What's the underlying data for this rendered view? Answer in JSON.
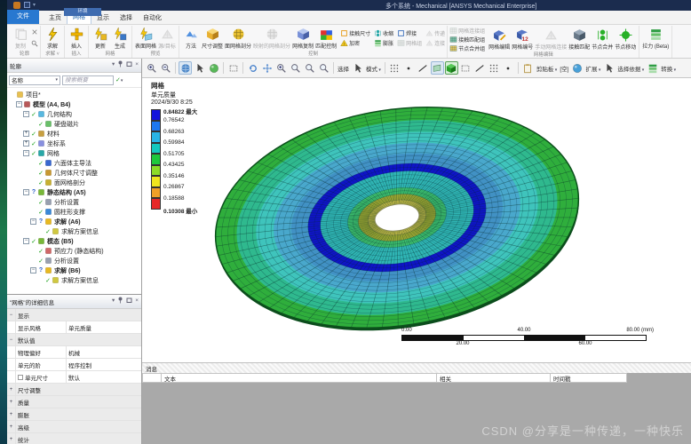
{
  "window": {
    "title": "多个系统 - Mechanical [ANSYS Mechanical Enterprise]",
    "context_tab": "环境"
  },
  "tabs": [
    {
      "label": "文件",
      "file": true
    },
    {
      "label": "主页"
    },
    {
      "label": "网格",
      "active": true
    },
    {
      "label": "显示"
    },
    {
      "label": "选择"
    },
    {
      "label": "自动化"
    }
  ],
  "ribbon": {
    "groups": [
      {
        "label": "轮廓",
        "buttons": [
          {
            "label": "复制",
            "icon": "copy-icon",
            "disabled": true
          }
        ],
        "side": [
          {
            "icon": "close-icon"
          },
          {
            "icon": "search-icon"
          }
        ]
      },
      {
        "label": "求解",
        "caret": true,
        "buttons": [
          {
            "label": "求解",
            "icon": "solve-bolt-icon"
          }
        ]
      },
      {
        "label": "插入",
        "buttons": [
          {
            "label": "插入",
            "icon": "plus-icon"
          }
        ]
      },
      {
        "label": "网格",
        "buttons": [
          {
            "label": "更新",
            "icon": "update-icon"
          },
          {
            "label": "生成",
            "icon": "generate-icon"
          }
        ]
      },
      {
        "label": "预览",
        "buttons": [
          {
            "label": "表面网格",
            "icon": "surface-mesh-icon"
          },
          {
            "label": "源/目标",
            "icon": "source-target-icon",
            "disabled": true
          }
        ]
      },
      {
        "label": "控制",
        "buttons": [
          {
            "label": "方法",
            "icon": "method-icon"
          },
          {
            "label": "尺寸调整",
            "icon": "sizing-icon"
          },
          {
            "label": "面网格剖分",
            "icon": "face-mesh-icon"
          },
          {
            "label": "映射的网格剖分",
            "icon": "mapped-mesh-icon",
            "disabled": true
          },
          {
            "label": "网格复制",
            "icon": "mesh-copy-icon"
          },
          {
            "label": "匹配控制",
            "icon": "match-control-icon"
          }
        ],
        "small": [
          {
            "label": "接触尺寸",
            "icon": "contact-sizing-icon"
          },
          {
            "label": "加密",
            "icon": "refinement-icon"
          },
          {
            "label": "收缩",
            "icon": "pinch-icon"
          },
          {
            "label": "膨胀",
            "icon": "inflation-icon"
          },
          {
            "label": "焊接",
            "icon": "weld-icon"
          },
          {
            "label": "网格组",
            "icon": "mesh-group-icon",
            "disabled": true
          },
          {
            "label": "传递",
            "icon": "transfer-icon",
            "disabled": true
          },
          {
            "label": "连接",
            "icon": "connect-icon",
            "disabled": true
          }
        ]
      },
      {
        "label": "网格编辑",
        "stack": [
          {
            "label": "网格连接组",
            "icon": "mesh-connection-group-icon",
            "disabled": true
          },
          {
            "label": "接触匹配组",
            "icon": "contact-match-group-icon"
          },
          {
            "label": "节点合并组",
            "icon": "node-merge-group-icon"
          }
        ],
        "buttons": [
          {
            "label": "网格编辑",
            "icon": "mesh-edit-icon"
          },
          {
            "label": "网格编号",
            "icon": "mesh-numbering-icon"
          },
          {
            "label": "手动网格连接",
            "icon": "manual-mesh-connection-icon",
            "disabled": true
          },
          {
            "label": "接触匹配",
            "icon": "contact-match-icon"
          },
          {
            "label": "节点合并",
            "icon": "node-merge-icon"
          },
          {
            "label": "节点移动",
            "icon": "node-move-icon"
          }
        ]
      },
      {
        "label": "",
        "buttons": [
          {
            "label": "拉力 (Beta)",
            "icon": "pull-icon"
          }
        ]
      }
    ]
  },
  "graphics_toolbar": {
    "items": [
      {
        "t": "icon",
        "n": "zoom-in-icon"
      },
      {
        "t": "icon",
        "n": "zoom-out-icon"
      },
      {
        "t": "sep"
      },
      {
        "t": "icon",
        "n": "globe-icon",
        "boxed": true
      },
      {
        "t": "icon",
        "n": "cursor-icon"
      },
      {
        "t": "icon",
        "n": "orbit-icon"
      },
      {
        "t": "sep"
      },
      {
        "t": "icon",
        "n": "select-box-icon"
      },
      {
        "t": "sep"
      },
      {
        "t": "icon",
        "n": "rotate-icon"
      },
      {
        "t": "icon",
        "n": "pan-icon"
      },
      {
        "t": "icon",
        "n": "zoom-icon"
      },
      {
        "t": "icon",
        "n": "zoom-area-icon"
      },
      {
        "t": "icon",
        "n": "zoom-fit-icon"
      },
      {
        "t": "icon",
        "n": "zoom-back-icon"
      },
      {
        "t": "sep"
      },
      {
        "t": "text",
        "label": "选择"
      },
      {
        "t": "icon",
        "n": "select-cursor-icon"
      },
      {
        "t": "text",
        "label": "模式",
        "caret": true
      },
      {
        "t": "sep"
      },
      {
        "t": "icon",
        "n": "dot-grid-icon"
      },
      {
        "t": "icon",
        "n": "vertex-filter-icon"
      },
      {
        "t": "icon",
        "n": "edge-filter-icon"
      },
      {
        "t": "icon",
        "n": "face-filter-icon",
        "boxed": true
      },
      {
        "t": "icon",
        "n": "body-filter-icon",
        "green": true
      },
      {
        "t": "icon",
        "n": "multi-filter-icon"
      },
      {
        "t": "icon",
        "n": "wire-filter-icon"
      },
      {
        "t": "icon",
        "n": "cluster-filter-icon"
      },
      {
        "t": "icon",
        "n": "snap-filter-icon"
      },
      {
        "t": "sep"
      },
      {
        "t": "icon",
        "n": "clipboard-icon"
      },
      {
        "t": "text",
        "label": "剪贴板",
        "caret": true
      },
      {
        "t": "text",
        "label": "[空]"
      },
      {
        "t": "icon",
        "n": "extend-icon"
      },
      {
        "t": "text",
        "label": "扩展",
        "caret": true
      },
      {
        "t": "icon",
        "n": "select-by-icon"
      },
      {
        "t": "text",
        "label": "选择依据",
        "caret": true
      },
      {
        "t": "icon",
        "n": "convert-icon"
      },
      {
        "t": "text",
        "label": "转换",
        "caret": true
      }
    ]
  },
  "outline": {
    "header": "轮廓",
    "filter_label": "名称",
    "search_placeholder": "搜索概要",
    "tree": [
      {
        "indent": 0,
        "icon": "project-icon",
        "label": "项目*"
      },
      {
        "indent": 1,
        "expand": "-",
        "icon": "model-icon",
        "label": "模型 (A4, B4)",
        "bold": true
      },
      {
        "indent": 2,
        "expand": "-",
        "status": "check",
        "icon": "geometry-icon",
        "label": "几何结构"
      },
      {
        "indent": 3,
        "status": "check",
        "icon": "body-icon",
        "label": "硬盘磁片"
      },
      {
        "indent": 2,
        "expand": "+",
        "status": "check",
        "icon": "materials-icon",
        "label": "材料"
      },
      {
        "indent": 2,
        "expand": "+",
        "status": "check",
        "icon": "csys-icon",
        "label": "坐标系"
      },
      {
        "indent": 2,
        "expand": "-",
        "status": "check",
        "icon": "mesh-icon",
        "label": "网格"
      },
      {
        "indent": 3,
        "status": "check",
        "icon": "method-tree-icon",
        "label": "六面体主导法"
      },
      {
        "indent": 3,
        "status": "check",
        "icon": "sizing-tree-icon",
        "label": "几何体尺寸调整"
      },
      {
        "indent": 3,
        "status": "check",
        "icon": "facemesh-tree-icon",
        "label": "面网格剖分"
      },
      {
        "indent": 2,
        "expand": "-",
        "status": "q",
        "icon": "analysis-icon",
        "label": "静态结构 (A5)",
        "bold": true
      },
      {
        "indent": 3,
        "status": "check",
        "icon": "settings-icon",
        "label": "分析设置"
      },
      {
        "indent": 3,
        "status": "check",
        "icon": "support-icon",
        "label": "圆柱形支撑"
      },
      {
        "indent": 3,
        "expand": "-",
        "status": "q",
        "icon": "solution-icon",
        "label": "求解 (A6)",
        "bold": true
      },
      {
        "indent": 4,
        "status": "check",
        "icon": "solution-info-icon",
        "label": "求解方案信息"
      },
      {
        "indent": 2,
        "expand": "-",
        "status": "check",
        "icon": "modal-icon",
        "label": "模态 (B5)",
        "bold": true
      },
      {
        "indent": 3,
        "status": "check",
        "icon": "prestress-icon",
        "label": "预应力 (静态结构)"
      },
      {
        "indent": 3,
        "status": "check",
        "icon": "settings-icon",
        "label": "分析设置"
      },
      {
        "indent": 3,
        "expand": "-",
        "status": "q",
        "icon": "solution-icon",
        "label": "求解 (B6)",
        "bold": true
      },
      {
        "indent": 4,
        "status": "check",
        "icon": "solution-info-icon",
        "label": "求解方案信息"
      }
    ]
  },
  "details": {
    "header": "\"网格\"的详细信息",
    "rows": [
      {
        "type": "section",
        "label": "显示"
      },
      {
        "type": "kv",
        "key": "显示风格",
        "value": "单元质量"
      },
      {
        "type": "section",
        "label": "默认值"
      },
      {
        "type": "kv",
        "key": "物理偏好",
        "value": "机械"
      },
      {
        "type": "kv",
        "key": "单元的阶",
        "value": "程序控制"
      },
      {
        "type": "kv",
        "key": "单元尺寸",
        "value": "默认",
        "checkbox": true
      },
      {
        "type": "collapsed",
        "label": "尺寸调整"
      },
      {
        "type": "collapsed",
        "label": "质量"
      },
      {
        "type": "collapsed",
        "label": "膨胀"
      },
      {
        "type": "collapsed",
        "label": "高级"
      },
      {
        "type": "collapsed",
        "label": "统计"
      }
    ]
  },
  "viewport": {
    "legend": {
      "title": "网格",
      "subtitle": "单元质量",
      "timestamp": "2024/9/30 8:25",
      "max_label": "最大",
      "min_label": "最小",
      "values": [
        "0.84822",
        "0.76542",
        "0.68263",
        "0.59984",
        "0.51705",
        "0.43425",
        "0.35146",
        "0.26867",
        "0.18588",
        "0.10308"
      ],
      "colors": [
        "#1414dc",
        "#1e78f0",
        "#28b4e6",
        "#14c8be",
        "#1ec83c",
        "#8cdc28",
        "#f0e61e",
        "#f0a028",
        "#e62828"
      ]
    },
    "scale_bar": {
      "top_labels": [
        "0.00",
        "40.00",
        "80.00 (mm)"
      ],
      "bottom_labels": [
        "20.00",
        "60.00"
      ],
      "segment_colors": [
        "#111111",
        "#ffffff",
        "#111111",
        "#ffffff"
      ]
    },
    "disc": {
      "bands": [
        {
          "r": 206,
          "color": "#2fae3c"
        },
        {
          "r": 182,
          "color": "#2fb98e"
        },
        {
          "r": 160,
          "color": "#3fc4bc"
        },
        {
          "r": 140,
          "color": "#49a8cc"
        },
        {
          "r": 120,
          "color": "#4191c4"
        },
        {
          "r": 101,
          "color": "#0f14c8"
        },
        {
          "r": 87,
          "color": "#2fb4b4"
        },
        {
          "r": 56,
          "color": "#3cbe6e"
        },
        {
          "r": 44,
          "color": "#a0aa32"
        },
        {
          "r": 33,
          "color": "#c8be46"
        },
        {
          "r": 25,
          "color": "#ffffff"
        }
      ]
    }
  },
  "messages": {
    "title": "消息",
    "columns": [
      "文本",
      "相关",
      "时间戳"
    ]
  },
  "watermark": "CSDN @分享是一种传递，一种快乐",
  "colors": {
    "titlebar": "#1b2c4e",
    "file_tab": "#2878d0",
    "context_badge": "#3f6cb0",
    "gray_body": "#a9a9a9"
  }
}
